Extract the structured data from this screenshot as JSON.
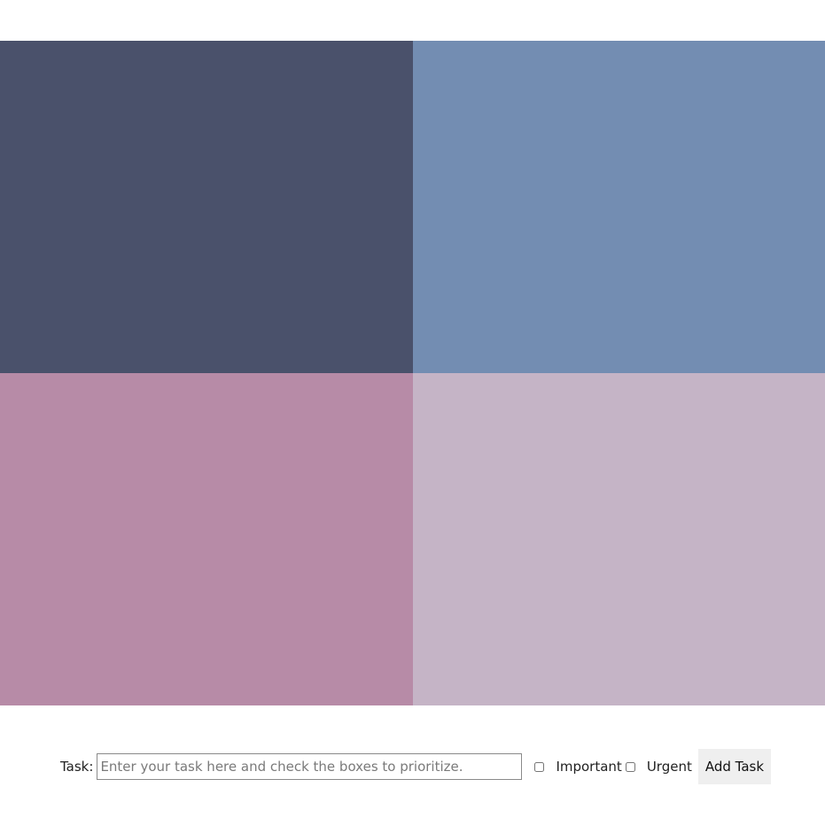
{
  "matrix": {
    "quadrants": [
      {
        "id": "q1",
        "color": "#4a516b"
      },
      {
        "id": "q2",
        "color": "#738db2"
      },
      {
        "id": "q3",
        "color": "#b78ba7"
      },
      {
        "id": "q4",
        "color": "#c5b4c6"
      }
    ]
  },
  "form": {
    "task_label": "Task:",
    "task_placeholder": "Enter your task here and check the boxes to prioritize.",
    "task_value": "",
    "important_label": "Important",
    "important_checked": false,
    "urgent_label": "Urgent",
    "urgent_checked": false,
    "add_button_label": "Add Task"
  }
}
